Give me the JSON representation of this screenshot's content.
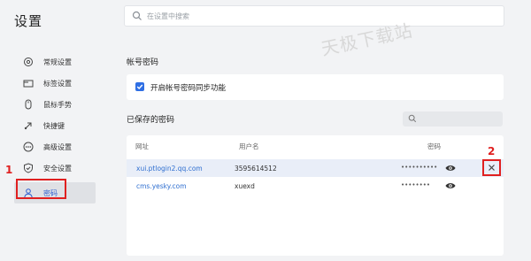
{
  "app": {
    "title": "设置"
  },
  "search": {
    "placeholder": "在设置中搜索"
  },
  "watermark": {
    "text": "天极下载站"
  },
  "sidebar": {
    "items": [
      {
        "label": "常规设置",
        "icon": "gear-icon"
      },
      {
        "label": "标签设置",
        "icon": "tab-icon"
      },
      {
        "label": "鼠标手势",
        "icon": "mouse-icon"
      },
      {
        "label": "快捷键",
        "icon": "shortcut-icon"
      },
      {
        "label": "高级设置",
        "icon": "more-icon"
      },
      {
        "label": "安全设置",
        "icon": "shield-icon"
      },
      {
        "label": "密码",
        "icon": "user-icon",
        "active": true
      }
    ]
  },
  "annotations": {
    "num1": "1",
    "num2": "2",
    "color": "#e02020"
  },
  "sync_section": {
    "title": "帐号密码",
    "checkbox_label": "开启帐号密码同步功能",
    "checked": true
  },
  "saved_section": {
    "title": "已保存的密码",
    "columns": {
      "site": "网址",
      "user": "用户名",
      "password": "密码"
    },
    "rows": [
      {
        "site": "xui.ptlogin2.qq.com",
        "user": "3595614512",
        "password": "••••••••••",
        "selected": true
      },
      {
        "site": "cms.yesky.com",
        "user": "xuexd",
        "password": "••••••••"
      }
    ]
  },
  "colors": {
    "accent": "#2f6fe4",
    "link": "#2f6fd0",
    "background": "#f2f3f5"
  }
}
